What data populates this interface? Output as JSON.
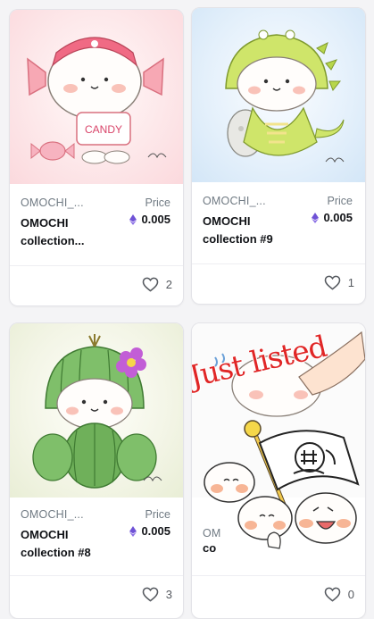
{
  "cards": [
    {
      "collection": "OMOCHI_...",
      "title": "OMOCHI collection...",
      "price_label": "Price",
      "price": "0.005",
      "likes": "2",
      "art_label": "CANDY"
    },
    {
      "collection": "OMOCHI_...",
      "title": "OMOCHI collection #9",
      "price_label": "Price",
      "price": "0.005",
      "likes": "1"
    },
    {
      "collection": "OMOCHI_...",
      "title": "OMOCHI collection #8",
      "price_label": "Price",
      "price": "0.005",
      "likes": "3"
    },
    {
      "collection": "OM",
      "title": "co",
      "likes": "0",
      "banner": "Just listed"
    }
  ],
  "colors": {
    "eth": "#6f52d6",
    "title": "#111317",
    "muted": "#707a83",
    "banner": "#e02626"
  }
}
